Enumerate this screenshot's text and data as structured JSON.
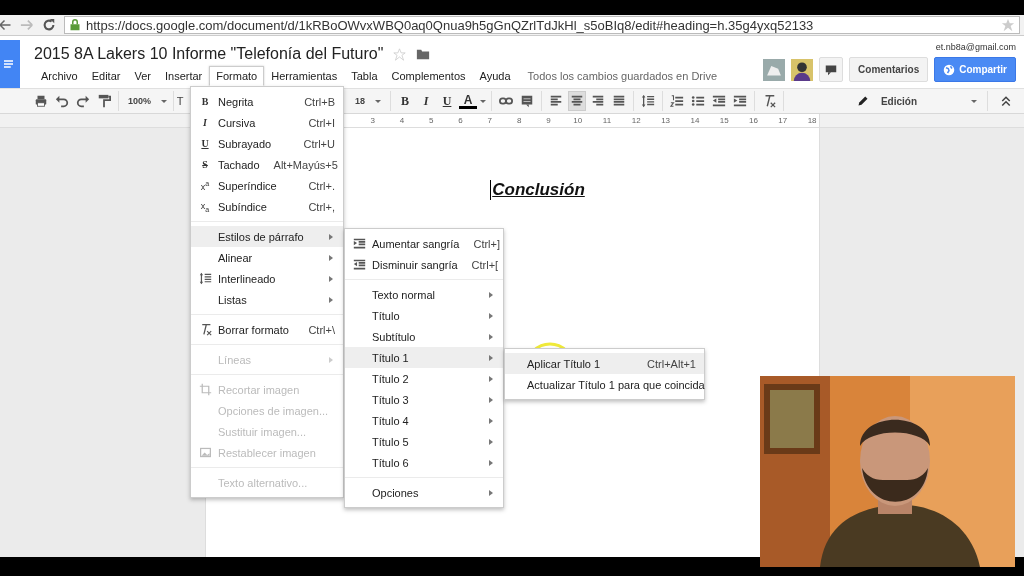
{
  "browser": {
    "url": "https://docs.google.com/document/d/1kRBoOWvxWBQ0aq0Qnua9h5gGnQZrlTdJkHl_s5oBIq8/edit#heading=h.35g4yxq52133"
  },
  "document": {
    "title": "2015 8A Lakers 10 Informe \"Telefonía del Futuro\"",
    "save_status": "Todos los cambios guardados en Drive",
    "account": "et.nb8a@gmail.com"
  },
  "menu_bar": [
    {
      "label": "Archivo",
      "selected": false
    },
    {
      "label": "Editar",
      "selected": false
    },
    {
      "label": "Ver",
      "selected": false
    },
    {
      "label": "Insertar",
      "selected": false
    },
    {
      "label": "Formato",
      "selected": true
    },
    {
      "label": "Herramientas",
      "selected": false
    },
    {
      "label": "Tabla",
      "selected": false
    },
    {
      "label": "Complementos",
      "selected": false
    },
    {
      "label": "Ayuda",
      "selected": false
    }
  ],
  "buttons": [
    {
      "label": "Comentarios",
      "kind": "plain"
    },
    {
      "label": "Compartir",
      "kind": "primary"
    }
  ],
  "toolbar": {
    "groups": [
      [
        {
          "kind": "icon"
        },
        {
          "kind": "icon"
        },
        {
          "kind": "icon"
        },
        {
          "kind": "icon"
        }
      ],
      [
        {
          "kind": "dropdown",
          "label": "100%"
        }
      ],
      [
        {
          "kind": "text",
          "label": "T"
        }
      ],
      [
        {
          "kind": "dropdown",
          "label": "18"
        }
      ],
      [
        {
          "kind": "glyph",
          "label": "B"
        },
        {
          "kind": "glyph",
          "label": "I"
        },
        {
          "kind": "glyph",
          "label": "U"
        },
        {
          "kind": "glyph",
          "label": "A"
        }
      ],
      [
        {
          "kind": "icon"
        },
        {
          "kind": "icon"
        }
      ],
      [
        {
          "kind": "align",
          "selected": false
        },
        {
          "kind": "align",
          "selected": true
        },
        {
          "kind": "align",
          "selected": false
        },
        {
          "kind": "align",
          "selected": false
        }
      ],
      [
        {
          "kind": "icon"
        }
      ],
      [
        {
          "kind": "icon"
        },
        {
          "kind": "icon"
        },
        {
          "kind": "icon"
        },
        {
          "kind": "icon"
        }
      ],
      [
        {
          "kind": "icon"
        }
      ]
    ],
    "mode": "Edición"
  },
  "ruler": [
    "3",
    "4",
    "5",
    "6",
    "7",
    "8",
    "9",
    "10",
    "11",
    "12",
    "13",
    "14",
    "15",
    "16",
    "17",
    "18"
  ],
  "page": {
    "heading": "Conclusión"
  },
  "format_menu": {
    "items": [
      {
        "kind": "item",
        "glyph": "B",
        "label": "Negrita",
        "shortcut": "Ctrl+B",
        "selected": false,
        "disabled": false
      },
      {
        "kind": "item",
        "glyph": "I",
        "label": "Cursiva",
        "shortcut": "Ctrl+I",
        "selected": false,
        "disabled": false
      },
      {
        "kind": "item",
        "glyph": "U",
        "label": "Subrayado",
        "shortcut": "Ctrl+U",
        "selected": false,
        "disabled": false
      },
      {
        "kind": "item",
        "glyph": "S",
        "label": "Tachado",
        "shortcut": "Alt+Mayús+5",
        "selected": false,
        "disabled": false
      },
      {
        "kind": "item",
        "glyph": "x$^{a}$",
        "label": "Superíndice",
        "shortcut": "Ctrl+.",
        "selected": false,
        "disabled": false
      },
      {
        "kind": "item",
        "glyph": "x$_{a}$",
        "label": "Subíndice",
        "shortcut": "Ctrl+,",
        "selected": false,
        "disabled": false
      },
      {
        "kind": "separator"
      },
      {
        "kind": "item",
        "label": "Estilos de párrafo",
        "submenu": true,
        "selected": true,
        "disabled": false
      },
      {
        "kind": "item",
        "label": "Alinear",
        "submenu": true,
        "selected": false,
        "disabled": false
      },
      {
        "kind": "item",
        "label": "Interlineado",
        "submenu": true,
        "selected": false,
        "disabled": false
      },
      {
        "kind": "item",
        "label": "Listas",
        "submenu": true,
        "selected": false,
        "disabled": false
      },
      {
        "kind": "separator"
      },
      {
        "kind": "item",
        "label": "Borrar formato",
        "shortcut": "Ctrl+\\",
        "selected": false,
        "disabled": false
      },
      {
        "kind": "separator"
      },
      {
        "kind": "item",
        "label": "Líneas",
        "submenu": true,
        "selected": false,
        "disabled": true
      },
      {
        "kind": "separator"
      },
      {
        "kind": "item",
        "label": "Recortar imagen",
        "selected": false,
        "disabled": true
      },
      {
        "kind": "item",
        "label": "Opciones de imagen...",
        "selected": false,
        "disabled": true
      },
      {
        "kind": "item",
        "label": "Sustituir imagen...",
        "selected": false,
        "disabled": true
      },
      {
        "kind": "item",
        "label": "Restablecer imagen",
        "selected": false,
        "disabled": true
      },
      {
        "kind": "separator"
      },
      {
        "kind": "item",
        "label": "Texto alternativo...",
        "selected": false,
        "disabled": true
      }
    ]
  },
  "styles_menu": {
    "items": [
      {
        "kind": "item",
        "label": "Aumentar sangría",
        "shortcut": "Ctrl+]",
        "selected": false,
        "disabled": false
      },
      {
        "kind": "item",
        "label": "Disminuir sangría",
        "shortcut": "Ctrl+[",
        "selected": false,
        "disabled": false
      },
      {
        "kind": "separator"
      },
      {
        "kind": "item",
        "label": "Texto normal",
        "submenu": true,
        "selected": false,
        "disabled": false
      },
      {
        "kind": "item",
        "label": "Título",
        "submenu": true,
        "selected": false,
        "disabled": false
      },
      {
        "kind": "item",
        "label": "Subtítulo",
        "submenu": true,
        "selected": false,
        "disabled": false
      },
      {
        "kind": "item",
        "label": "Título 1",
        "submenu": true,
        "selected": true,
        "disabled": false
      },
      {
        "kind": "item",
        "label": "Título 2",
        "submenu": true,
        "selected": false,
        "disabled": false
      },
      {
        "kind": "item",
        "label": "Título 3",
        "submenu": true,
        "selected": false,
        "disabled": false
      },
      {
        "kind": "item",
        "label": "Título 4",
        "submenu": true,
        "selected": false,
        "disabled": false
      },
      {
        "kind": "item",
        "label": "Título 5",
        "submenu": true,
        "selected": false,
        "disabled": false
      },
      {
        "kind": "item",
        "label": "Título 6",
        "submenu": true,
        "selected": false,
        "disabled": false
      },
      {
        "kind": "separator"
      },
      {
        "kind": "item",
        "label": "Opciones",
        "submenu": true,
        "selected": false,
        "disabled": false
      }
    ]
  },
  "heading_menu": {
    "items": [
      {
        "kind": "item",
        "label": "Aplicar Título 1",
        "shortcut": "Ctrl+Alt+1",
        "selected": true,
        "disabled": false
      },
      {
        "kind": "item",
        "label": "Actualizar Título 1 para que coincida",
        "selected": false,
        "disabled": false
      }
    ]
  }
}
